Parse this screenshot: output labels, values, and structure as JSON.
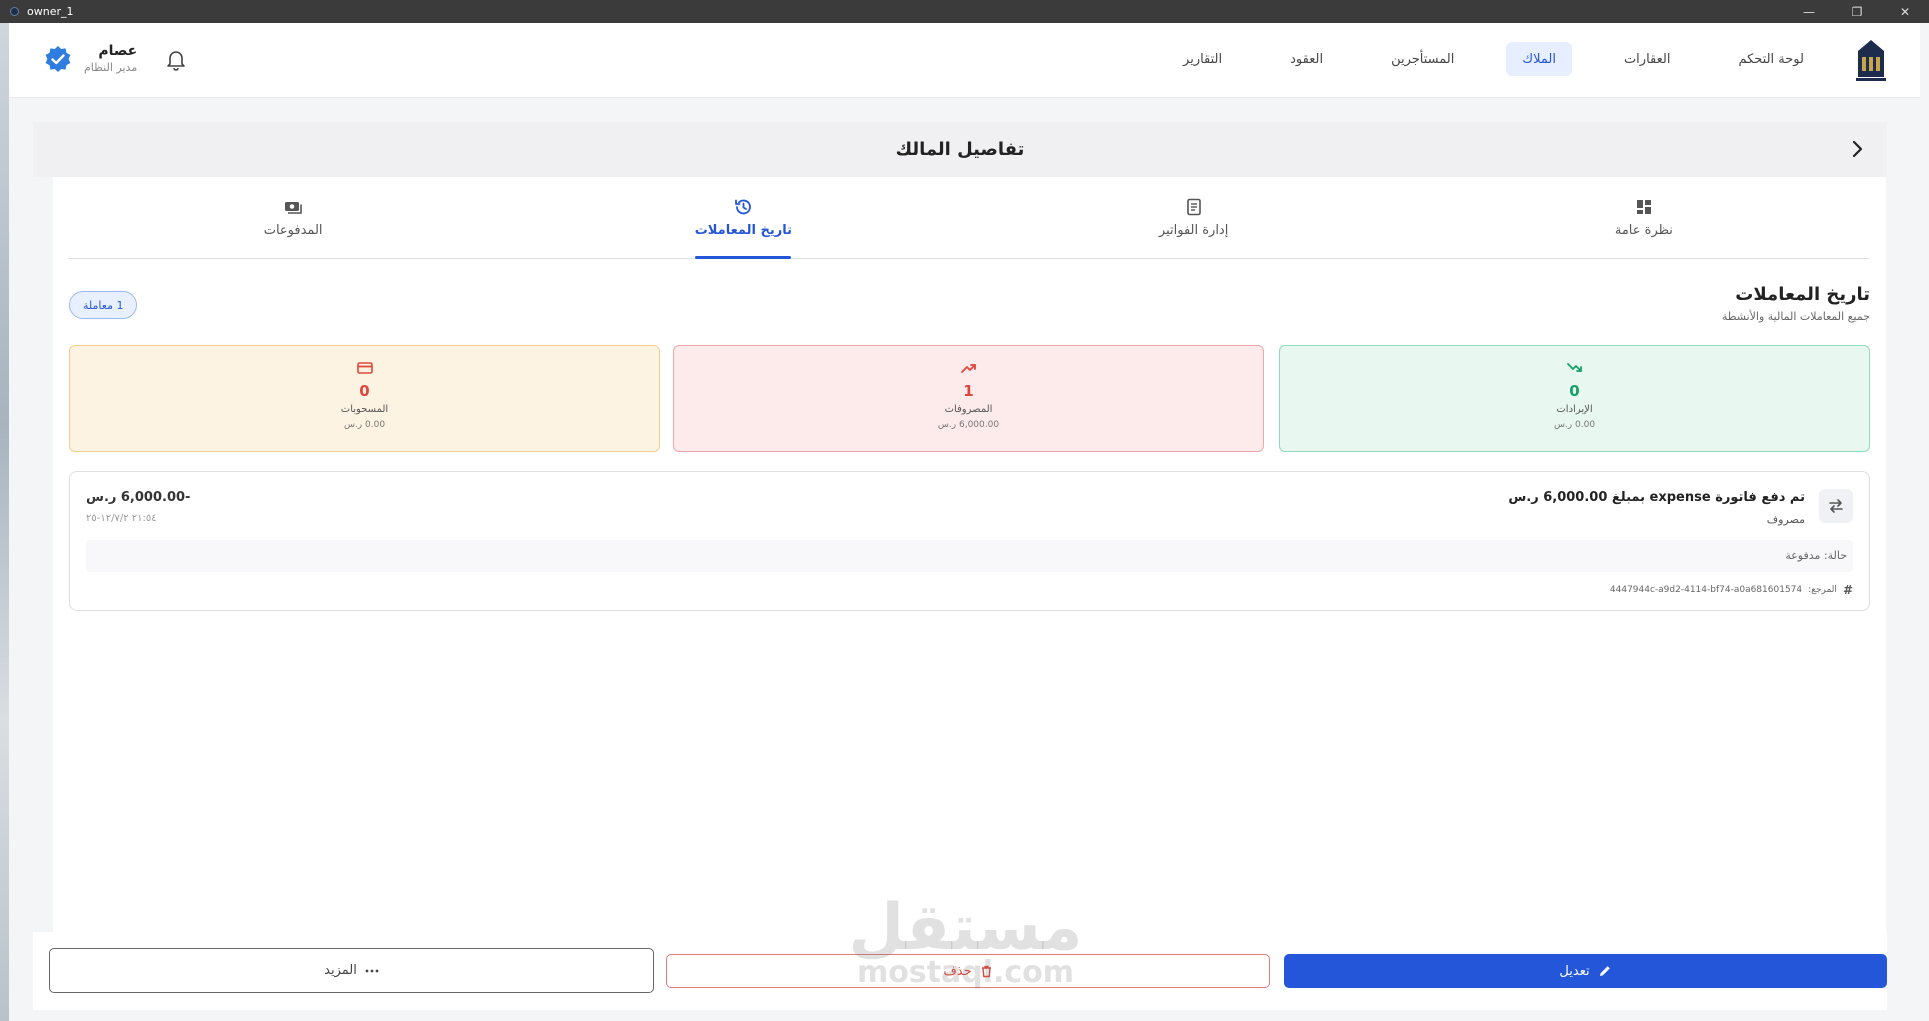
{
  "window": {
    "title": "owner_1",
    "controls": [
      "—",
      "❐",
      "✕"
    ]
  },
  "header": {
    "nav": [
      {
        "label": "لوحة التحكم",
        "active": false
      },
      {
        "label": "العقارات",
        "active": false
      },
      {
        "label": "الملاك",
        "active": true
      },
      {
        "label": "المستأجرين",
        "active": false
      },
      {
        "label": "العقود",
        "active": false
      },
      {
        "label": "التقارير",
        "active": false
      }
    ],
    "user": {
      "name": "عصام",
      "role": "مدير النظام"
    },
    "accent": "#2456d9"
  },
  "page": {
    "title": "تفاصيل المالك"
  },
  "tabs": [
    {
      "label": "نظرة عامة",
      "icon": "dashboard-icon",
      "active": false
    },
    {
      "label": "إدارة الفواتير",
      "icon": "invoice-icon",
      "active": false
    },
    {
      "label": "تاريخ المعاملات",
      "icon": "history-icon",
      "active": true
    },
    {
      "label": "المدفوعات",
      "icon": "payments-icon",
      "active": false
    }
  ],
  "section": {
    "title": "تاريخ المعاملات",
    "subtitle": "جميع المعاملات المالية والأنشطة",
    "count_badge": "1 معاملة"
  },
  "stats": {
    "income": {
      "count": "0",
      "label": "الإيرادات",
      "amount": "0.00 ر.س",
      "color": "#18a06a"
    },
    "expense": {
      "count": "1",
      "label": "المصروفات",
      "amount": "6,000.00 ر.س",
      "color": "#e0473c"
    },
    "pending": {
      "count": "0",
      "label": "المسحوبات",
      "amount": "0.00 ر.س",
      "color": "#e0473c"
    }
  },
  "transaction": {
    "title": "تم دفع فاتورة expense بمبلغ 6,000.00 ر.س",
    "type": "مصروف",
    "amount": "-6,000.00 ر.س",
    "date": "٢١:٥٤ ١٢/٧/٢-٢٥",
    "status": "حالة: مدفوعة",
    "ref_label": "المرجع:",
    "ref_value": "4447944c-a9d2-4114-bf74-a0a681601574"
  },
  "actions": {
    "edit": "تعديل",
    "delete": "حذف",
    "more": "المزيد"
  },
  "watermark": {
    "line1": "مستقل",
    "line2": "mostaql.com"
  }
}
